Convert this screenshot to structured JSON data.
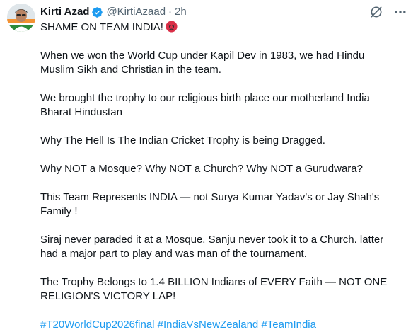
{
  "author": {
    "name": "Kirti Azad",
    "handle": "@KirtiAzaad",
    "separator": "·",
    "time": "2h"
  },
  "icons": {
    "verified": "verified-badge-icon",
    "grok": "grok-icon",
    "more": "more-options-icon",
    "emoji": "angry-face-emoji"
  },
  "colors": {
    "text": "#0f1419",
    "muted": "#536471",
    "link": "#1d9bf0",
    "verified": "#1d9bf0"
  },
  "tweet": {
    "line_1": "SHAME ON TEAM INDIA!",
    "para_2": "When we won the World Cup under Kapil Dev in 1983, we had Hindu\nMuslim Sikh and Christian in the team.",
    "para_3": "We brought the trophy to our religious birth place our motherland India\nBharat Hindustan",
    "para_4": "Why The Hell Is The Indian Cricket Trophy is being Dragged.",
    "para_5": "Why NOT a Mosque? Why NOT a Church? Why NOT a Gurudwara?",
    "para_6": "This Team Represents INDIA — not Surya Kumar Yadav's or Jay Shah's\nFamily !",
    "para_7": "Siraj never paraded it at a Mosque. Sanju never took it to a Church. latter\nhad a major part to play and was man of the tournament.",
    "para_8": "The Trophy Belongs to 1.4 BILLION Indians of EVERY Faith — NOT ONE\nRELIGION'S VICTORY LAP!",
    "hashtags": [
      "#T20WorldCup2026final",
      "#IndiaVsNewZealand",
      "#TeamIndia"
    ]
  }
}
